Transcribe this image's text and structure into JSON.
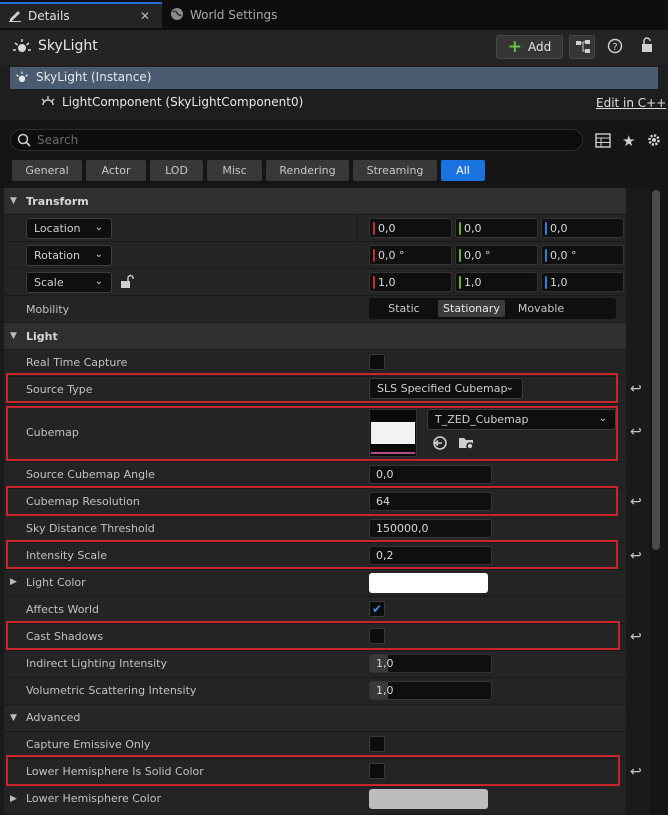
{
  "tabs": [
    {
      "label": "Details",
      "icon": "pencil-icon",
      "closable": true
    },
    {
      "label": "World Settings",
      "icon": "globe-icon"
    }
  ],
  "header": {
    "title": "SkyLight",
    "add_label": "Add"
  },
  "tree": {
    "instance": "SkyLight (Instance)",
    "component": "LightComponent (SkyLightComponent0)",
    "edit_link": "Edit in C++"
  },
  "search": {
    "placeholder": "Search"
  },
  "filters": [
    "General",
    "Actor",
    "LOD",
    "Misc",
    "Rendering",
    "Streaming",
    "All"
  ],
  "active_filter": "All",
  "transform": {
    "title": "Transform",
    "location": {
      "label": "Location",
      "x": "0,0",
      "y": "0,0",
      "z": "0,0"
    },
    "rotation": {
      "label": "Rotation",
      "x": "0,0 °",
      "y": "0,0 °",
      "z": "0,0 °"
    },
    "scale": {
      "label": "Scale",
      "x": "1,0",
      "y": "1,0",
      "z": "1,0"
    },
    "mobility": {
      "label": "Mobility",
      "options": [
        "Static",
        "Stationary",
        "Movable"
      ],
      "selected": "Stationary"
    }
  },
  "light": {
    "title": "Light",
    "real_time_capture": {
      "label": "Real Time Capture",
      "checked": false
    },
    "source_type": {
      "label": "Source Type",
      "value": "SLS Specified Cubemap"
    },
    "cubemap": {
      "label": "Cubemap",
      "asset": "T_ZED_Cubemap"
    },
    "source_cubemap_angle": {
      "label": "Source Cubemap Angle",
      "value": "0,0"
    },
    "cubemap_resolution": {
      "label": "Cubemap Resolution",
      "value": "64"
    },
    "sky_distance_threshold": {
      "label": "Sky Distance Threshold",
      "value": "150000,0"
    },
    "intensity_scale": {
      "label": "Intensity Scale",
      "value": "0,2"
    },
    "light_color": {
      "label": "Light Color",
      "color": "#ffffff"
    },
    "affects_world": {
      "label": "Affects World",
      "checked": true
    },
    "cast_shadows": {
      "label": "Cast Shadows",
      "checked": false
    },
    "indirect_lighting_intensity": {
      "label": "Indirect Lighting Intensity",
      "value": "1,0"
    },
    "volumetric_scattering_intensity": {
      "label": "Volumetric Scattering Intensity",
      "value": "1,0"
    }
  },
  "advanced": {
    "title": "Advanced",
    "capture_emissive_only": {
      "label": "Capture Emissive Only",
      "checked": false
    },
    "lower_hemisphere_is_solid_color": {
      "label": "Lower Hemisphere Is Solid Color",
      "checked": false
    },
    "lower_hemisphere_color": {
      "label": "Lower Hemisphere Color",
      "color": "#bdbdbd"
    }
  },
  "colors": {
    "accent": "#1a72e0",
    "highlight_box": "#c8262c",
    "axis_x": "#c8302c",
    "axis_y": "#6cb23a",
    "axis_z": "#2f7fd8"
  }
}
